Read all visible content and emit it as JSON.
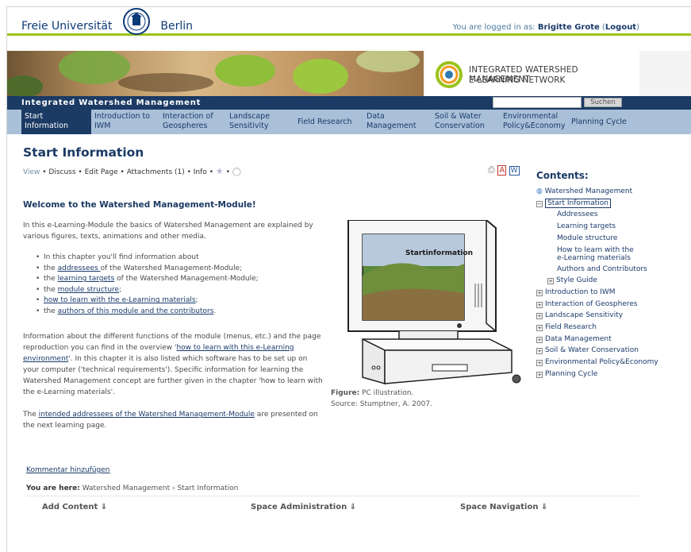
{
  "header": {
    "brand_left": "Freie Universität",
    "brand_right": "Berlin",
    "login_prefix": "You are logged in as: ",
    "user": "Brigitte Grote",
    "logout": "Logout"
  },
  "banner": {
    "line1": "INTEGRATED WATERSHED MANAGEMENT",
    "line2": "E-LEARNING NETWORK"
  },
  "sitebar": {
    "title": "Integrated Watershed Management",
    "search_button": "Suchen"
  },
  "nav": [
    {
      "label": "Start\nInformation"
    },
    {
      "label": "Introduction to\nIWM"
    },
    {
      "label": "Interaction of\nGeospheres"
    },
    {
      "label": "Landscape\nSensitivity"
    },
    {
      "label": "Field Research"
    },
    {
      "label": "Data\nManagement"
    },
    {
      "label": "Soil & Water\nConservation"
    },
    {
      "label": "Environmental\nPolicy&Economy"
    },
    {
      "label": "Planning Cycle"
    }
  ],
  "page": {
    "title": "Start Information",
    "actions": {
      "view": "View",
      "discuss": "Discuss",
      "edit": "Edit Page",
      "attachments": "Attachments (1)",
      "info": "Info"
    },
    "welcome": "Welcome to the Watershed Management-Module!",
    "intro": "In this e-Learning-Module the basics of Watershed Management are explained by various figures, texts, animations and other media.",
    "bullets": {
      "b1": "In this chapter you'll find information about",
      "b2_pre": "the ",
      "b2_link": "addressees ",
      "b2_post": "of the Watershed Management-Module;",
      "b3_pre": "the ",
      "b3_link": "learning targets",
      "b3_post": " of the Watershed Management-Module;",
      "b4_pre": "the ",
      "b4_link": "module structure",
      "b4_post": ";",
      "b5_link": "how to learn with the e-Learning materials",
      "b5_post": ";",
      "b6_pre": "the ",
      "b6_link": "authors of this module and the contributors",
      "b6_post": "."
    },
    "info_para": {
      "pre": "Information about the different functions of the module (menus, etc.) and the page reproduction you can find in the overview '",
      "link": "how to learn with this e-Learning environment",
      "post": "'. In this chapter it is also listed which software has to be set up on your computer ('technical requirements'). Specific information for learning the Watershed Management concept are further given in the chapter 'how to learn with the e-Learning materials'."
    },
    "addr_para": {
      "pre": "The ",
      "link": "intended addressees of the Watershed Management-Module",
      "post": " are presented on the next learning page."
    },
    "figure": {
      "screen_text": "Startinformation",
      "caption_label": "Figure:",
      "caption_text": " PC illustration.",
      "source": "Source: Stumptner, A. 2007."
    }
  },
  "contents": {
    "heading": "Contents:",
    "root": "Watershed Management",
    "current": "Start Information",
    "children": [
      "Addressees",
      "Learning targets",
      "Module structure",
      "How to learn with the",
      "e-Learning materials",
      "Authors and Contributors",
      "Style Guide"
    ],
    "top": [
      "Introduction to IWM",
      "Interaction of Geospheres",
      "Landscape Sensitivity",
      "Field Research",
      "Data Management",
      "Soil & Water Conservation",
      "Environmental Policy&Economy",
      "Planning Cycle"
    ]
  },
  "footer": {
    "kommentar": "Kommentar hinzufügen",
    "here_label": "You are here:",
    "crumb1": "Watershed Management",
    "sep": "›",
    "crumb2": "Start Information",
    "add_content": "Add Content ⇓",
    "space_admin": "Space Administration ⇓",
    "space_nav": "Space Navigation ⇓"
  }
}
